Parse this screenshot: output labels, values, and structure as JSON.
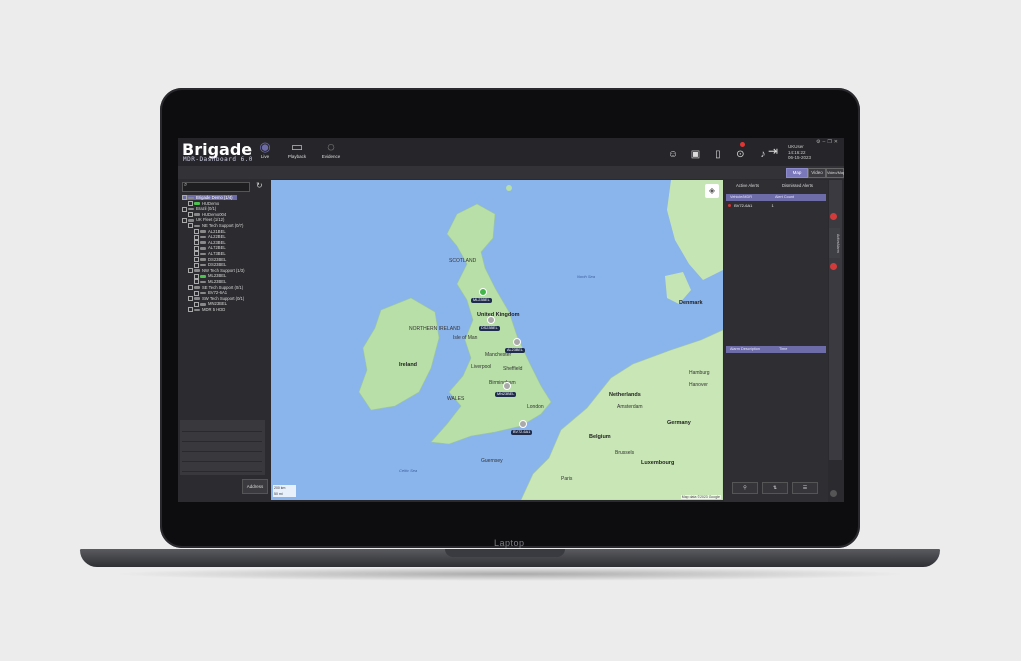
{
  "device": {
    "label": "Laptop"
  },
  "app": {
    "logo": "Brigade",
    "subtitle": "MDR-Dashboard 6.0",
    "nav": [
      {
        "label": "Live",
        "icon": "eye-icon"
      },
      {
        "label": "Playback",
        "icon": "video-camera-icon"
      },
      {
        "label": "Evidence",
        "icon": "chat-bubble-icon"
      }
    ],
    "user": {
      "name": "UKUser",
      "time": "14:16:22",
      "date": "06-15-2023"
    },
    "view_tabs": [
      "Map",
      "Video",
      "Video/Map"
    ]
  },
  "sidebar": {
    "tree": [
      {
        "label": "Brigade Demo (1/4)",
        "level": 0,
        "selected": true
      },
      {
        "label": "HUDemo",
        "level": 1,
        "live": true
      },
      {
        "label": "Brazil (0/1)",
        "level": 0
      },
      {
        "label": "HUDemo004",
        "level": 1
      },
      {
        "label": "UK Fleet (1/12)",
        "level": 0
      },
      {
        "label": "NE Tech Support (0/7)",
        "level": 1
      },
      {
        "label": "AL21BEL",
        "level": 2
      },
      {
        "label": "AL22BEL",
        "level": 2
      },
      {
        "label": "AL23BEL",
        "level": 2
      },
      {
        "label": "AL72BEL",
        "level": 2
      },
      {
        "label": "AL73BEL",
        "level": 2
      },
      {
        "label": "DS23BEL",
        "level": 2
      },
      {
        "label": "DS23BEL",
        "level": 2
      },
      {
        "label": "NW Tech Support (1/3)",
        "level": 1
      },
      {
        "label": "ML23BEL",
        "level": 2,
        "live": true
      },
      {
        "label": "ML23BEL",
        "level": 2
      },
      {
        "label": "SE Tech Support (0/1)",
        "level": 1
      },
      {
        "label": "BV72-6A1",
        "level": 2
      },
      {
        "label": "SW Tech Support (0/1)",
        "level": 1
      },
      {
        "label": "MN23BEL",
        "level": 2
      },
      {
        "label": "MDR 5 HDD",
        "level": 1
      }
    ],
    "address_button": "Address"
  },
  "map": {
    "labels": [
      {
        "text": "SCOTLAND",
        "kind": "region"
      },
      {
        "text": "North Sea",
        "kind": "sea"
      },
      {
        "text": "United Kingdom",
        "kind": "country"
      },
      {
        "text": "Isle of Man",
        "kind": "place"
      },
      {
        "text": "NORTHERN IRELAND",
        "kind": "region"
      },
      {
        "text": "Ireland",
        "kind": "country"
      },
      {
        "text": "WALES",
        "kind": "region"
      },
      {
        "text": "Manchester",
        "kind": "place"
      },
      {
        "text": "Liverpool",
        "kind": "place"
      },
      {
        "text": "Sheffield",
        "kind": "place"
      },
      {
        "text": "Birmingham",
        "kind": "place"
      },
      {
        "text": "London",
        "kind": "place"
      },
      {
        "text": "Celtic Sea",
        "kind": "sea"
      },
      {
        "text": "Denmark",
        "kind": "country"
      },
      {
        "text": "Netherlands",
        "kind": "country"
      },
      {
        "text": "Amsterdam",
        "kind": "place"
      },
      {
        "text": "Belgium",
        "kind": "country"
      },
      {
        "text": "Brussels",
        "kind": "place"
      },
      {
        "text": "Luxembourg",
        "kind": "country"
      },
      {
        "text": "Germany",
        "kind": "country"
      },
      {
        "text": "Hamburg",
        "kind": "place"
      },
      {
        "text": "Hanover",
        "kind": "place"
      },
      {
        "text": "Paris",
        "kind": "place"
      },
      {
        "text": "Guernsey",
        "kind": "place"
      }
    ],
    "vehicles": [
      {
        "id": "ML23BEL",
        "live": true
      },
      {
        "id": "DS23BEL",
        "live": false
      },
      {
        "id": "AL23BEL",
        "live": false
      },
      {
        "id": "MN23BEL",
        "live": false
      },
      {
        "id": "BV72-6A1",
        "live": false
      }
    ],
    "scale_text": [
      "200 km",
      "50 mi"
    ],
    "attribution": "Map data ©2023 Google"
  },
  "right_panel": {
    "tabs": [
      "Active Alerts",
      "Dismissed Alerts"
    ],
    "table_headers": [
      "Vehicle/MDR",
      "Alert Count"
    ],
    "rows": [
      {
        "vehicle": "BV72-6A1",
        "count": "1"
      }
    ],
    "lower_headers": [
      "Alarm Description",
      "Time"
    ],
    "vertical_tab": "ActiveAlarm"
  },
  "colors": {
    "accent": "#6d6ba8",
    "live": "#43b649",
    "alert": "#e03030",
    "water": "#8ab4ec",
    "land": "#b7dfa7"
  }
}
